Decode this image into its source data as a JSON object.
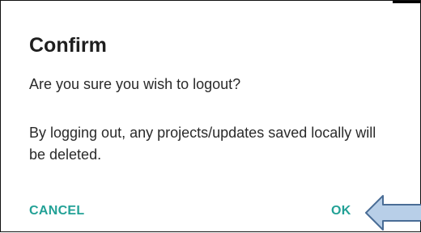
{
  "dialog": {
    "title": "Confirm",
    "message": "Are you sure you wish to logout?",
    "detail": "By logging out, any projects/updates saved locally will be deleted.",
    "cancel_label": "CANCEL",
    "ok_label": "OK"
  },
  "colors": {
    "accent": "#22a196",
    "arrow_fill": "#b8cfe8",
    "arrow_stroke": "#4a6d96"
  },
  "icons": {
    "pointer": "left-arrow-icon"
  }
}
